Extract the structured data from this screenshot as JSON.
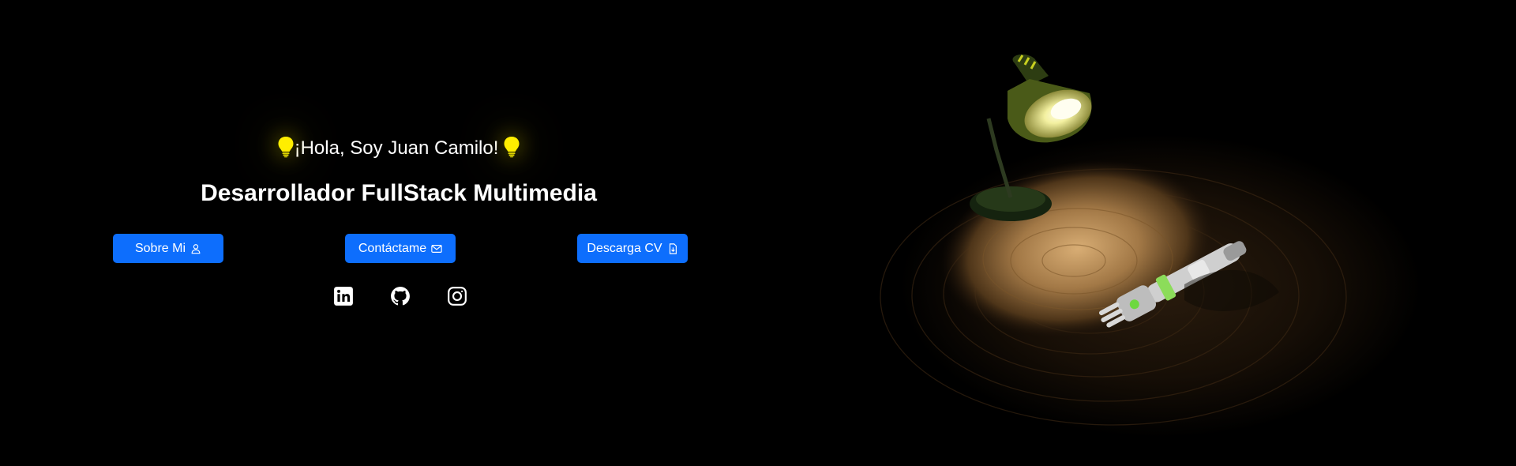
{
  "hero": {
    "greeting": "¡Hola, Soy Juan Camilo!",
    "title": "Desarrollador FullStack Multimedia"
  },
  "buttons": {
    "about_label": "Sobre Mi",
    "contact_label": "Contáctame",
    "cv_label": "Descarga CV"
  },
  "icons": {
    "greeting_left": "lightbulb-icon",
    "greeting_right": "lightbulb-icon",
    "about": "person-icon",
    "contact": "envelope-icon",
    "cv": "file-download-icon",
    "social": [
      "linkedin-icon",
      "github-icon",
      "instagram-icon"
    ]
  },
  "colors": {
    "background": "#000000",
    "accent": "#0d6efd",
    "bulb": "#ffee00",
    "text": "#ffffff"
  }
}
